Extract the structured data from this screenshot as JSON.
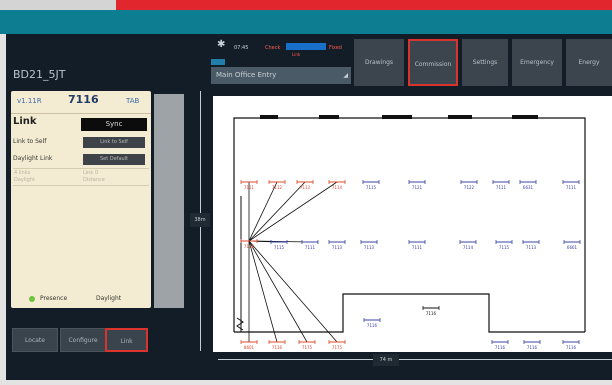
{
  "device": {
    "title": "BD21_5JT"
  },
  "panel": {
    "header": {
      "left": "v1.11R",
      "center": "7116",
      "right": "TAB"
    },
    "link_heading": "Link",
    "sync_label": "Sync",
    "rows": [
      {
        "label": "Link to Self",
        "value": "Link to Self"
      },
      {
        "label": "Daylight Link",
        "value": "Set Default"
      }
    ],
    "faint_rows": [
      "4 links",
      "Link 0",
      "Daylight",
      "Distance"
    ],
    "legend": {
      "presence": "Presence",
      "daylight": "Daylight"
    },
    "presence_color": "#6fc33f"
  },
  "bottom_buttons": [
    {
      "label": "Locate",
      "selected": false
    },
    {
      "label": "Configure",
      "selected": false
    },
    {
      "label": "Link",
      "selected": true
    }
  ],
  "status": {
    "icon": "bluetooth-icon",
    "time": "07:45",
    "signal_text": "Check",
    "signal_sub": "Link",
    "result_text": "Fixed",
    "alert_color": "#ff5a4f",
    "bar_color": "#1a6fc9"
  },
  "dropdown": {
    "value": "Main Office Entry"
  },
  "tabs": [
    {
      "label": "Drawings",
      "selected": false
    },
    {
      "label": "Commission",
      "selected": true
    },
    {
      "label": "Settings",
      "selected": false
    },
    {
      "label": "Emergency",
      "selected": false
    },
    {
      "label": "Energy",
      "selected": false
    }
  ],
  "floorplan": {
    "height_label": "38m",
    "width_label": "74 m",
    "source_color": "#e0492a",
    "fixture_color": "#3844a8",
    "fixtures_top": [
      "7111",
      "7112",
      "7113",
      "7114",
      "7115",
      "7121",
      "7122",
      "7111",
      "6631",
      "7111",
      "6672",
      "6613"
    ],
    "fixtures_mid": [
      "7115",
      "7111",
      "7113",
      "7113",
      "7111",
      "7114",
      "7115",
      "7113",
      "6661",
      "7114"
    ],
    "fixtures_bottom": [
      "8601",
      "7116",
      "7175",
      "7175",
      "7116",
      "7116",
      "7116",
      "7116"
    ],
    "fixtures_room": [
      "7116",
      "7116"
    ]
  }
}
